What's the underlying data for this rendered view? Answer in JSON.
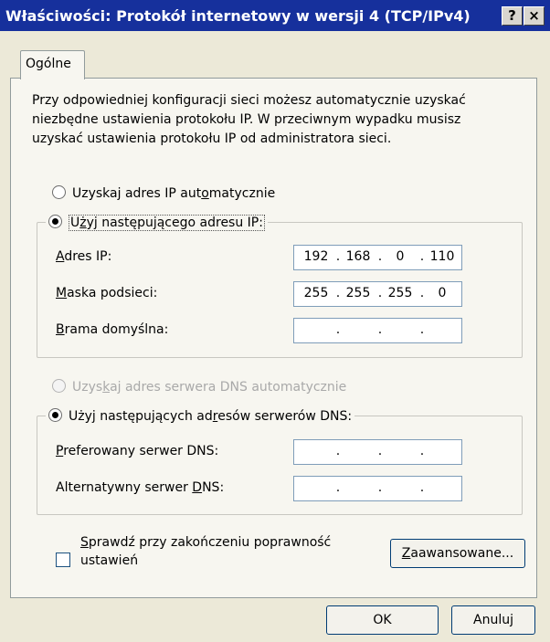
{
  "window": {
    "title": "Właściwości: Protokół internetowy w wersji 4 (TCP/IPv4)",
    "help_label": "?",
    "close_label": "×"
  },
  "tabs": [
    {
      "label": "Ogólne"
    }
  ],
  "intro": {
    "line1": "Przy odpowiedniej konfiguracji sieci możesz automatycznie uzyskać",
    "line2": "niezbędne ustawienia protokołu IP. W przeciwnym wypadku musisz",
    "line3": "uzyskać ustawienia protokołu IP od administratora sieci."
  },
  "ip": {
    "auto": {
      "pre": "Uzyskaj adres IP aut",
      "key": "o",
      "post": "matycznie",
      "selected": false
    },
    "manual": {
      "pre": "U",
      "key": "ż",
      "post": "yj następującego adresu IP:",
      "selected": true
    },
    "fields": [
      {
        "key": "A",
        "rest": "dres IP:",
        "octets": [
          "192",
          "168",
          "0",
          "110"
        ]
      },
      {
        "key": "M",
        "rest": "aska podsieci:",
        "octets": [
          "255",
          "255",
          "255",
          "0"
        ]
      },
      {
        "key": "B",
        "rest": "rama domyślna:",
        "octets": [
          "",
          "",
          "",
          ""
        ]
      }
    ]
  },
  "dns": {
    "auto": {
      "pre": "Uzys",
      "key": "k",
      "post": "aj adres serwera DNS automatycznie",
      "selected": false,
      "disabled": true
    },
    "manual": {
      "pre": "Użyj następujących ad",
      "key": "r",
      "post": "esów serwerów DNS:",
      "selected": true
    },
    "fields": [
      {
        "pre": "",
        "key": "P",
        "post": "referowany serwer DNS:",
        "octets": [
          "",
          "",
          "",
          ""
        ]
      },
      {
        "pre": "Alternatywny serwer ",
        "key": "D",
        "post": "NS:",
        "octets": [
          "",
          "",
          "",
          ""
        ]
      }
    ]
  },
  "validate": {
    "key": "S",
    "line1_rest": "prawdź przy zakończeniu poprawność",
    "line2": "ustawień",
    "checked": false
  },
  "advanced_button": {
    "key": "Z",
    "rest": "aawansowane..."
  },
  "ok_button": "OK",
  "cancel_button": "Anuluj"
}
